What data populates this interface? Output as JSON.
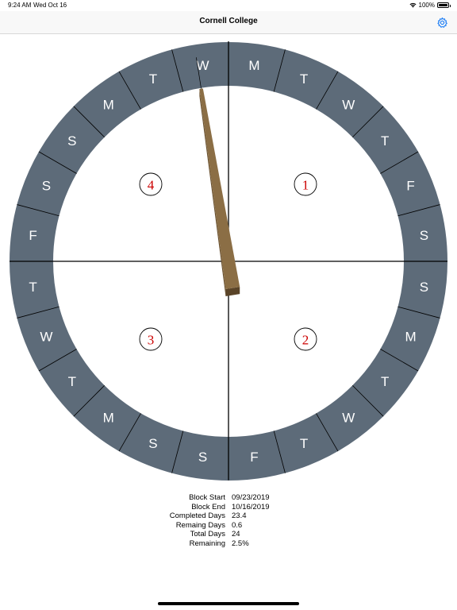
{
  "status_bar": {
    "time": "9:24 AM",
    "date": "Wed Oct 16",
    "battery": "100%"
  },
  "nav": {
    "title": "Cornell College",
    "settings_icon": "gear-icon"
  },
  "dial": {
    "ring_color": "#5d6b79",
    "hand_color": "#8b6e45",
    "quadrant_label_color": "#cc0000",
    "day_letters": [
      "M",
      "T",
      "W",
      "T",
      "F",
      "S",
      "S",
      "M",
      "T",
      "W",
      "T",
      "F",
      "S",
      "S",
      "M",
      "T",
      "W",
      "T",
      "F",
      "S",
      "S",
      "M",
      "T",
      "W"
    ],
    "quadrants": [
      "1",
      "2",
      "3",
      "4"
    ],
    "completed_fraction": 0.975
  },
  "stats": {
    "block_start_label": "Block Start",
    "block_start": "09/23/2019",
    "block_end_label": "Block End",
    "block_end": "10/16/2019",
    "completed_days_label": "Completed Days",
    "completed_days": "23.4",
    "remaining_days_label": "Remaing Days",
    "remaining_days": "0.6",
    "total_days_label": "Total Days",
    "total_days": "24",
    "remaining_label": "Remaining",
    "remaining": "2.5%"
  }
}
